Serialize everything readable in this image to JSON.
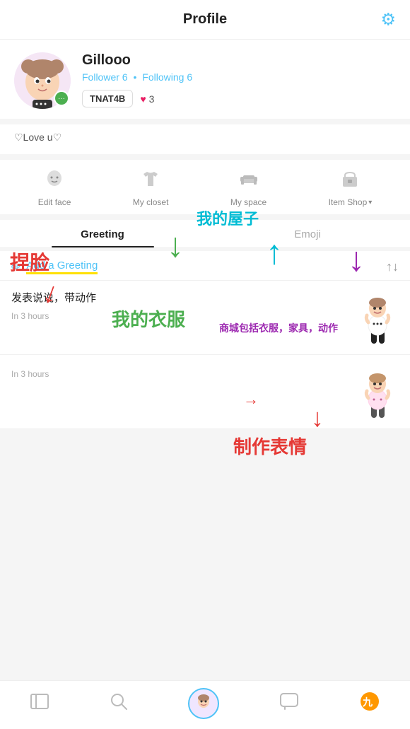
{
  "header": {
    "title": "Profile",
    "gear_icon": "⚙"
  },
  "profile": {
    "username": "Gillooo",
    "follower_label": "Follower",
    "follower_count": "6",
    "following_label": "Following",
    "following_count": "6",
    "dot": "•",
    "badge_tag": "TNAT4B",
    "heart_count": "3",
    "bio": "♡Love u♡"
  },
  "icons": [
    {
      "id": "edit-face",
      "icon": "👤",
      "label": "Edit face"
    },
    {
      "id": "my-closet",
      "icon": "👕",
      "label": "My closet"
    },
    {
      "id": "my-space",
      "icon": "🛋",
      "label": "My space"
    },
    {
      "id": "item-shop",
      "icon": "🏪",
      "label": "Item Shop",
      "has_dropdown": true
    }
  ],
  "tabs": [
    {
      "id": "greeting",
      "label": "Greeting",
      "active": true
    },
    {
      "id": "emoji",
      "label": "Emoji",
      "active": false
    }
  ],
  "greeting": {
    "add_label": "Add a Greeting",
    "pencil": "✏"
  },
  "posts": [
    {
      "text": "发表说说，带动作",
      "time": "In 3 hours"
    },
    {
      "text": "",
      "time": "In 3 hours"
    }
  ],
  "annotations": {
    "tijian": "捏脸",
    "wode_yifu": "我的衣服",
    "wode_wuzi": "我的屋子",
    "shangcheng": "商城包括衣服，家具，动作",
    "zhizuo": "制作表情"
  },
  "bottom_nav": [
    {
      "id": "book",
      "icon": "📖",
      "active": false
    },
    {
      "id": "search",
      "icon": "🔍",
      "active": false
    },
    {
      "id": "avatar",
      "icon": "avatar",
      "active": true
    },
    {
      "id": "chat",
      "icon": "💬",
      "active": false
    },
    {
      "id": "jiuyou",
      "icon": "🎮",
      "active": false
    }
  ]
}
